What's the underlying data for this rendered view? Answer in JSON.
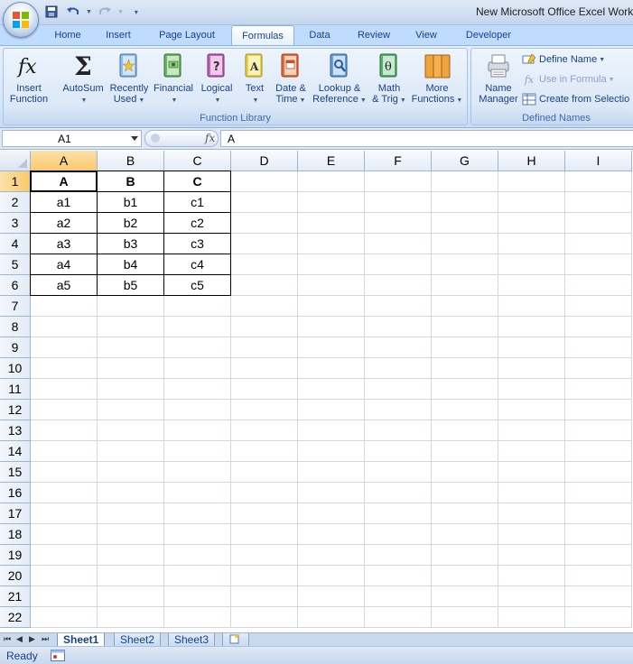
{
  "window": {
    "title": "New Microsoft Office Excel Work"
  },
  "tabs": [
    "Home",
    "Insert",
    "Page Layout",
    "Formulas",
    "Data",
    "Review",
    "View",
    "Developer"
  ],
  "active_tab": "Formulas",
  "ribbon": {
    "function_library": {
      "label": "Function Library",
      "buttons": [
        {
          "line1": "Insert",
          "line2": "Function",
          "icon": "fx-icon"
        },
        {
          "line1": "AutoSum",
          "line2": "",
          "icon": "sigma-icon"
        },
        {
          "line1": "Recently",
          "line2": "Used",
          "icon": "star-book-icon"
        },
        {
          "line1": "Financial",
          "line2": "",
          "icon": "money-book-icon"
        },
        {
          "line1": "Logical",
          "line2": "",
          "icon": "question-book-icon"
        },
        {
          "line1": "Text",
          "line2": "",
          "icon": "text-book-icon"
        },
        {
          "line1": "Date &",
          "line2": "Time",
          "icon": "calendar-book-icon"
        },
        {
          "line1": "Lookup &",
          "line2": "Reference",
          "icon": "magnifier-book-icon"
        },
        {
          "line1": "Math",
          "line2": "& Trig",
          "icon": "theta-book-icon"
        },
        {
          "line1": "More",
          "line2": "Functions",
          "icon": "books-icon"
        }
      ]
    },
    "defined_names": {
      "label": "Defined Names",
      "name_manager": {
        "line1": "Name",
        "line2": "Manager"
      },
      "define_name": "Define Name",
      "use_in_formula": "Use in Formula",
      "create_from_selection": "Create from Selectio"
    }
  },
  "formula_bar": {
    "name_box": "A1",
    "fx_label": "fx",
    "content": "A"
  },
  "grid": {
    "columns": [
      "A",
      "B",
      "C",
      "D",
      "E",
      "F",
      "G",
      "H",
      "I"
    ],
    "rows": [
      "1",
      "2",
      "3",
      "4",
      "5",
      "6",
      "7",
      "8",
      "9",
      "10",
      "11",
      "12",
      "13",
      "14",
      "15",
      "16",
      "17",
      "18",
      "19",
      "20",
      "21",
      "22"
    ],
    "cells": [
      [
        "A",
        "B",
        "C"
      ],
      [
        "a1",
        "b1",
        "c1"
      ],
      [
        "a2",
        "b2",
        "c2"
      ],
      [
        "a3",
        "b3",
        "c3"
      ],
      [
        "a4",
        "b4",
        "c4"
      ],
      [
        "a5",
        "b5",
        "c5"
      ]
    ],
    "active_cell": "A1"
  },
  "sheets": [
    "Sheet1",
    "Sheet2",
    "Sheet3"
  ],
  "active_sheet": "Sheet1",
  "status": {
    "text": "Ready"
  }
}
